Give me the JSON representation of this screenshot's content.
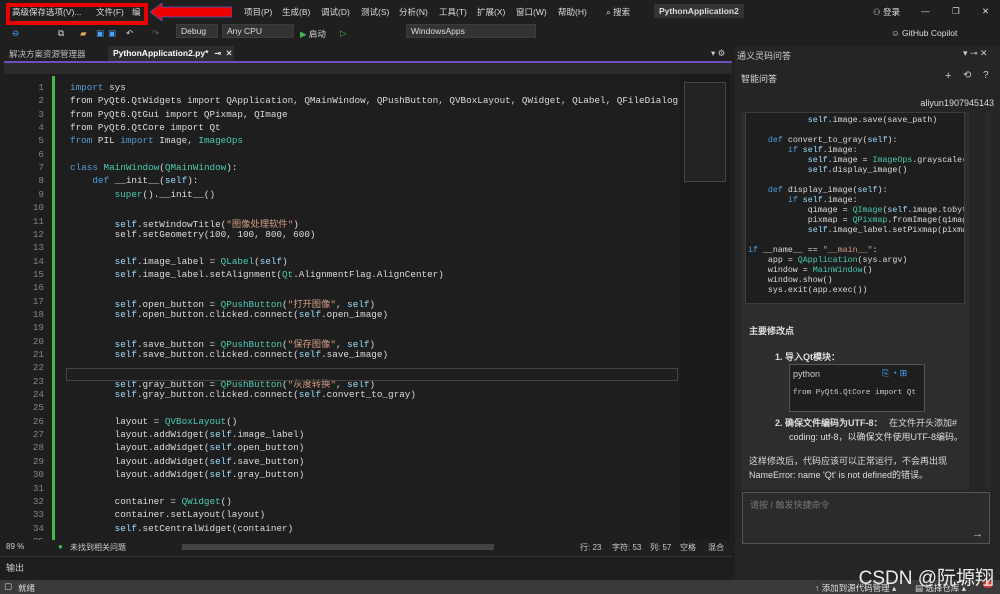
{
  "titlebar": {
    "menus": [
      "高级保存选项(V)...",
      "文件(F)",
      "编",
      "项目(P)",
      "生成(B)",
      "调试(D)",
      "测试(S)",
      "分析(N)",
      "工具(T)",
      "扩展(X)",
      "窗口(W)",
      "帮助(H)"
    ],
    "search": "搜索",
    "project": "PythonApplication2",
    "login": "登录"
  },
  "toolbar": {
    "config": "Debug",
    "platform": "Any CPU",
    "start": "启动",
    "target": "WindowsApps",
    "copilot": "GitHub Copilot"
  },
  "tabs": {
    "solution": "解决方案资源管理器",
    "file": "PythonApplication2.py*"
  },
  "colors": {
    "accent": "#6c4fbd",
    "highlight": "#ff0000",
    "gutter_changed": "#3fb950"
  },
  "code": [
    "import sys",
    "from PyQt6.QtWidgets import QApplication, QMainWindow, QPushButton, QVBoxLayout, QWidget, QLabel, QFileDialog",
    "from PyQt6.QtGui import QPixmap, QImage",
    "from PyQt6.QtCore import Qt",
    "from PIL import Image, ImageOps",
    "",
    "class MainWindow(QMainWindow):",
    "    def __init__(self):",
    "        super().__init__()",
    "",
    "        self.setWindowTitle(\"图像处理软件\")",
    "        self.setGeometry(100, 100, 800, 600)",
    "",
    "        self.image_label = QLabel(self)",
    "        self.image_label.setAlignment(Qt.AlignmentFlag.AlignCenter)",
    "",
    "        self.open_button = QPushButton(\"打开图像\", self)",
    "        self.open_button.clicked.connect(self.open_image)",
    "",
    "        self.save_button = QPushButton(\"保存图像\", self)",
    "        self.save_button.clicked.connect(self.save_image)",
    "",
    "        self.gray_button = QPushButton(\"灰度转换\", self)",
    "        self.gray_button.clicked.connect(self.convert_to_gray)",
    "",
    "        layout = QVBoxLayout()",
    "        layout.addWidget(self.image_label)",
    "        layout.addWidget(self.open_button)",
    "        layout.addWidget(self.save_button)",
    "        layout.addWidget(self.gray_button)",
    "",
    "        container = QWidget()",
    "        container.setLayout(layout)",
    "        self.setCentralWidget(container)",
    ""
  ],
  "editor_status": {
    "zoom": "89 %",
    "issues": "未找到相关问题",
    "line": "行: 23",
    "char": "字符: 53",
    "col": "列: 57",
    "spaces": "空格",
    "eol": "混合"
  },
  "output": {
    "title": "输出"
  },
  "statusbar": {
    "ready": "就绪",
    "add_source": "添加到源代码管理",
    "select_repo": "选择仓库",
    "notifications": "1"
  },
  "panel": {
    "title": "通义灵码问答",
    "subtitle": "智能问答",
    "user": "aliyun1907945143",
    "code": [
      "            self.image.save(save_path)",
      "",
      "    def convert_to_gray(self):",
      "        if self.image:",
      "            self.image = ImageOps.grayscale(se",
      "            self.display_image()",
      "",
      "    def display_image(self):",
      "        if self.image:",
      "            qimage = QImage(self.image.tobytes",
      "            pixmap = QPixmap.fromImage(qimage)",
      "            self.image_label.setPixmap(pixmap.",
      "",
      "if __name__ == \"__main__\":",
      "    app = QApplication(sys.argv)",
      "    window = MainWindow()",
      "    window.show()",
      "    sys.exit(app.exec())"
    ],
    "heading": "主要修改点",
    "item1": "1.  导入Qt模块：",
    "snippet_lang": "python",
    "snippet": "from PyQt6.QtCore import Qt",
    "item2_bold": "2.  确保文件编码为UTF-8：",
    "item2_text": "在文件开头添加#",
    "item2_text2": "coding: utf-8，以确保文件使用UTF-8编码。",
    "summary1": "这样修改后，代码应该可以正常运行，不会再出现",
    "summary2": "NameError: name 'Qt' is not defined的错误。",
    "input_placeholder": "请按 / 触发快捷命令"
  },
  "watermark": "CSDN @阮塬翔"
}
